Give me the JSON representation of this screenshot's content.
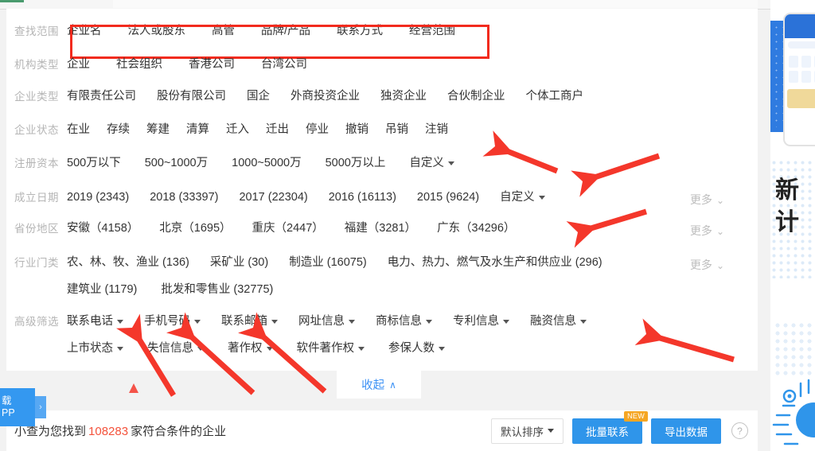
{
  "panel": {
    "rows": [
      {
        "label": "查找范围",
        "items": [
          "企业名",
          "法人或股东",
          "高管",
          "品牌/产品",
          "联系方式",
          "经营范围"
        ]
      },
      {
        "label": "机构类型",
        "items": [
          "企业",
          "社会组织",
          "香港公司",
          "台湾公司"
        ]
      },
      {
        "label": "企业类型",
        "items": [
          "有限责任公司",
          "股份有限公司",
          "国企",
          "外商投资企业",
          "独资企业",
          "合伙制企业",
          "个体工商户"
        ]
      },
      {
        "label": "企业状态",
        "items": [
          "在业",
          "存续",
          "筹建",
          "清算",
          "迁入",
          "迁出",
          "停业",
          "撤销",
          "吊销",
          "注销"
        ]
      },
      {
        "label": "注册资本",
        "items": [
          "500万以下",
          "500~1000万",
          "1000~5000万",
          "5000万以上"
        ],
        "custom": "自定义"
      },
      {
        "label": "成立日期",
        "items": [
          "2019 (2343)",
          "2018 (33397)",
          "2017 (22304)",
          "2016 (16113)",
          "2015 (9624)"
        ],
        "custom": "自定义",
        "more": "更多"
      },
      {
        "label": "省份地区",
        "items": [
          "安徽（4158）",
          "北京（1695）",
          "重庆（2447）",
          "福建（3281）",
          "广东（34296）"
        ],
        "more": "更多"
      },
      {
        "label": "行业门类",
        "items": [
          "农、林、牧、渔业 (136)",
          "采矿业 (30)",
          "制造业 (16075)",
          "电力、热力、燃气及水生产和供应业 (296)"
        ],
        "items2": [
          "建筑业 (1179)",
          "批发和零售业 (32775)"
        ],
        "more": "更多"
      },
      {
        "label": "高级筛选",
        "dropdowns": [
          "联系电话",
          "手机号码",
          "联系邮箱",
          "网址信息",
          "商标信息",
          "专利信息",
          "融资信息"
        ],
        "dropdowns2": [
          "上市状态",
          "失信信息",
          "著作权",
          "软件著作权",
          "参保人数"
        ]
      }
    ]
  },
  "collapse": {
    "label": "收起",
    "chevron": "∧"
  },
  "results": {
    "prefix": "小查为您找到",
    "count": "108283",
    "suffix": "家符合条件的企业",
    "sort_label": "默认排序",
    "contact_button": "批量联系",
    "contact_badge": "NEW",
    "export_button": "导出数据",
    "help_icon": "?"
  },
  "app_tab": {
    "line1": "载",
    "line2": "PP",
    "arrow": "›"
  },
  "ads": {
    "banner_char1": "新",
    "banner_char2": "计"
  },
  "colors": {
    "highlight_red": "#f22b1e",
    "arrow_red": "#f4372b",
    "primary_blue": "#2f95ea",
    "link_blue": "#3d92f5",
    "count_red": "#f4523b",
    "badge_orange": "#f5a623"
  }
}
